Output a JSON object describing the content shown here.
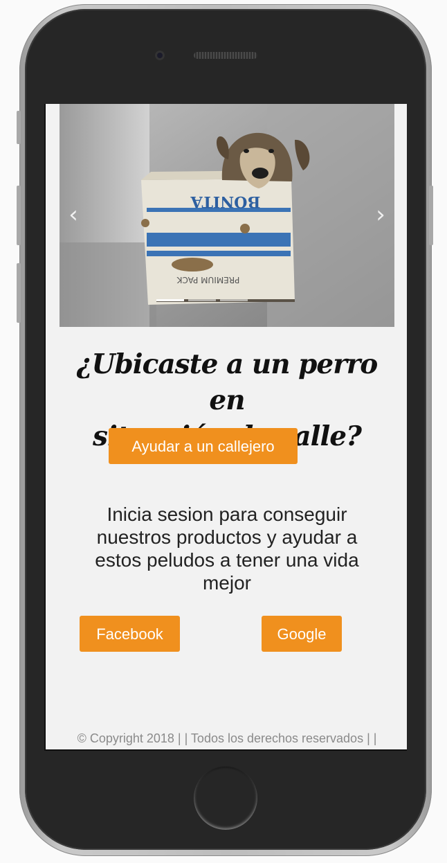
{
  "carousel": {
    "prev_icon": "chevron-left-icon",
    "next_icon": "chevron-right-icon",
    "prev_glyph": "‹",
    "next_glyph": "›",
    "slides": 3,
    "active_slide": 1,
    "box_text_1": "BONITA",
    "box_text_2": "PREMIUM PACK"
  },
  "headline": {
    "line1": "¿Ubicaste a un perro en",
    "line2": "situación de calle?"
  },
  "help_button": {
    "label": "Ayudar a un callejero"
  },
  "login": {
    "text": "Inicia sesion para conseguir nuestros productos y ayudar a estos peludos a tener una vida mejor"
  },
  "social": {
    "facebook_label": "Facebook",
    "google_label": "Google"
  },
  "footer": {
    "text": "© Copyright 2018 | | Todos los derechos reservados | |"
  },
  "colors": {
    "accent": "#f0901e",
    "screen_bg": "#f2f2f2",
    "text": "#222222",
    "footer_text": "#8a8a8a"
  }
}
